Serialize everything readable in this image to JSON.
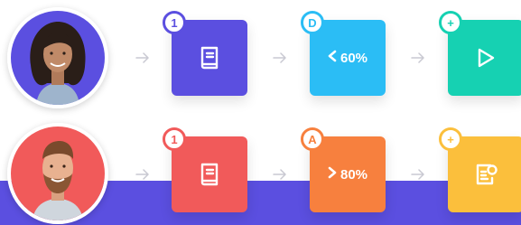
{
  "colors": {
    "band": "#5b4fe0",
    "card_purple": "#5b4fe0",
    "card_cyan": "#2bbdf5",
    "card_teal": "#16d1b2",
    "card_red": "#f15a5a",
    "card_orange": "#f7803e",
    "card_yellow": "#fbbf3c",
    "arrow": "#c9c9d2"
  },
  "rows": [
    {
      "cards": [
        {
          "badge": "1",
          "icon": "book-icon",
          "value": ""
        },
        {
          "badge": "D",
          "icon": "",
          "value": "60%",
          "comparator": "<"
        },
        {
          "badge": "+",
          "icon": "play-icon",
          "value": ""
        }
      ]
    },
    {
      "cards": [
        {
          "badge": "1",
          "icon": "book-icon",
          "value": ""
        },
        {
          "badge": "A",
          "icon": "",
          "value": "80%",
          "comparator": ">"
        },
        {
          "badge": "+",
          "icon": "certificate-icon",
          "value": ""
        }
      ]
    }
  ]
}
